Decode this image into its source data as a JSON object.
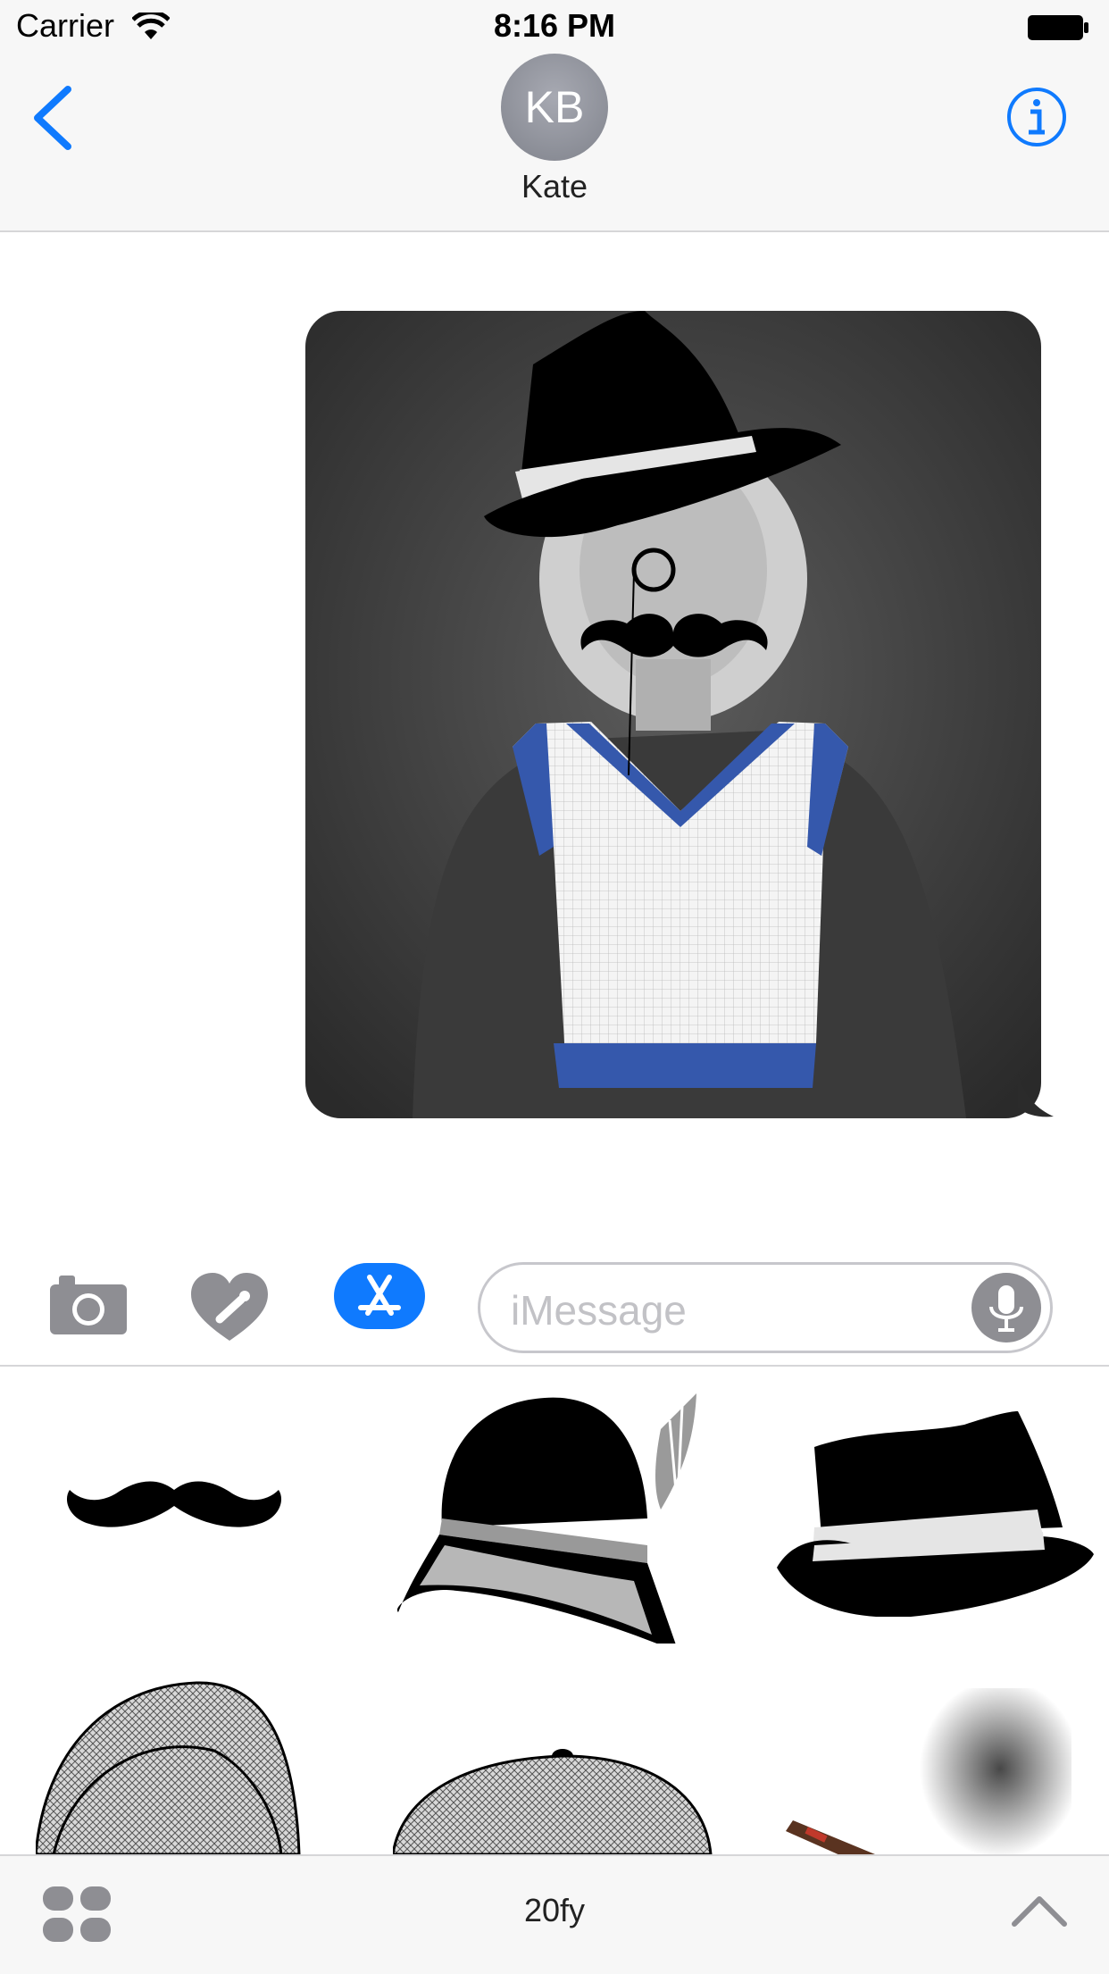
{
  "status_bar": {
    "carrier": "Carrier",
    "time": "8:16 PM"
  },
  "nav": {
    "avatar_initials": "KB",
    "contact_name": "Kate",
    "back_icon": "chevron-left-icon",
    "info_icon": "info-icon"
  },
  "compose": {
    "placeholder": "iMessage",
    "camera_icon": "camera-icon",
    "digital_touch_icon": "heart-touch-icon",
    "app_store_icon": "app-store-icon",
    "mic_icon": "microphone-icon"
  },
  "drawer": {
    "stickers": [
      "mustache",
      "bowler-hat-feather",
      "fedora",
      "tweed-cap-side",
      "tweed-cap-front",
      "cigar-smoke"
    ]
  },
  "app_bar": {
    "app_name": "20fy",
    "drawer_icon": "app-grid-icon",
    "expand_icon": "chevron-up-icon"
  },
  "colors": {
    "accent": "#0f7afe",
    "apron_trim": "#3558ac"
  }
}
